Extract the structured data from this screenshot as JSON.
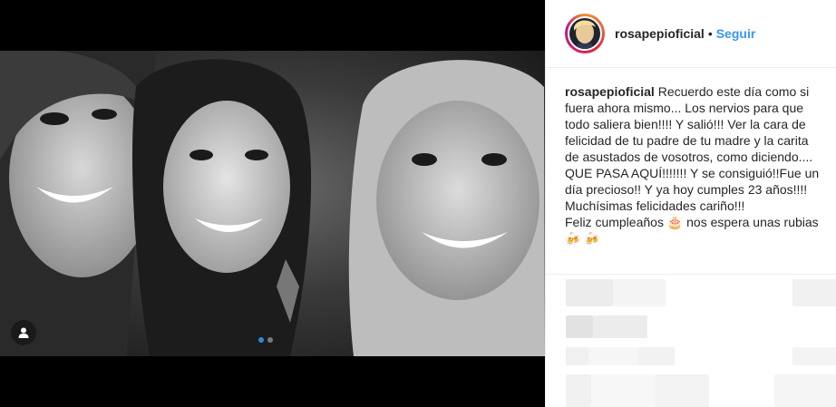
{
  "post": {
    "username": "rosapepioficial",
    "separator": "•",
    "follow_label": "Seguir",
    "caption_user": "rosapepioficial",
    "caption_text": " Recuerdo este día como si fuera ahora mismo... Los nervios para que todo saliera bien!!!! Y salió!!! Ver la cara de felicidad de tu padre de tu madre y la carita de asustados de vosotros, como diciendo....\nQUE PASA AQUÍ!!!!!!! Y se consiguió!!Fue un día precioso!! Y ya hoy cumples 23 años!!!!\nMuchísimas felicidades cariño!!!\nFeliz cumpleaños 🎂 nos espera unas rubias 🍻 🍻"
  },
  "media": {
    "carousel_index": 1,
    "carousel_count": 2
  },
  "colors": {
    "link": "#3897f0",
    "text": "#262626",
    "border": "#efefef"
  },
  "icons": [
    "user-tag-icon"
  ]
}
